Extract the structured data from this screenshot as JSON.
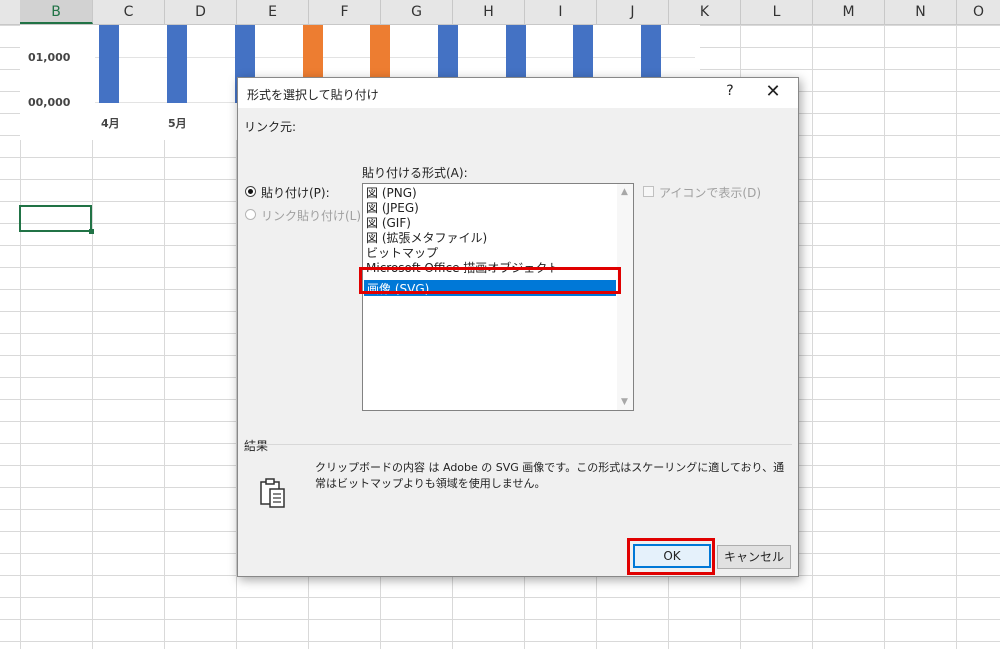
{
  "spreadsheet": {
    "columns": [
      "B",
      "C",
      "D",
      "E",
      "F",
      "G",
      "H",
      "I",
      "J",
      "K",
      "L",
      "M",
      "N",
      "O"
    ],
    "selected_column": "B"
  },
  "chart": {
    "y_tick_labels": [
      "01,000",
      "00,000"
    ],
    "x_tick_labels": [
      "4月",
      "5月"
    ],
    "bar_colors": {
      "blue": "#4472c4",
      "orange": "#ed7d31"
    }
  },
  "dialog": {
    "title": "形式を選択して貼り付け",
    "help_label": "?",
    "close_label": "✕",
    "source_label": "リンク元:",
    "paste_as_label": "貼り付ける形式(A):",
    "radio_paste": "貼り付け(P):",
    "radio_paste_link": "リンク貼り付け(L):",
    "display_as_icon": "アイコンで表示(D)",
    "formats": [
      "図 (PNG)",
      "図 (JPEG)",
      "図 (GIF)",
      "図 (拡張メタファイル)",
      "ビットマップ",
      "Microsoft Office 描画オブジェクト",
      "画像 (SVG)"
    ],
    "selected_format_index": 6,
    "result_label": "結果",
    "result_text": "クリップボードの内容 は Adobe の SVG 画像です。この形式はスケーリングに適しており、通常はビットマップよりも領域を使用しません。",
    "ok_label": "OK",
    "cancel_label": "キャンセル",
    "highlight_color": "#e00000",
    "selection_color": "#0078d7"
  }
}
